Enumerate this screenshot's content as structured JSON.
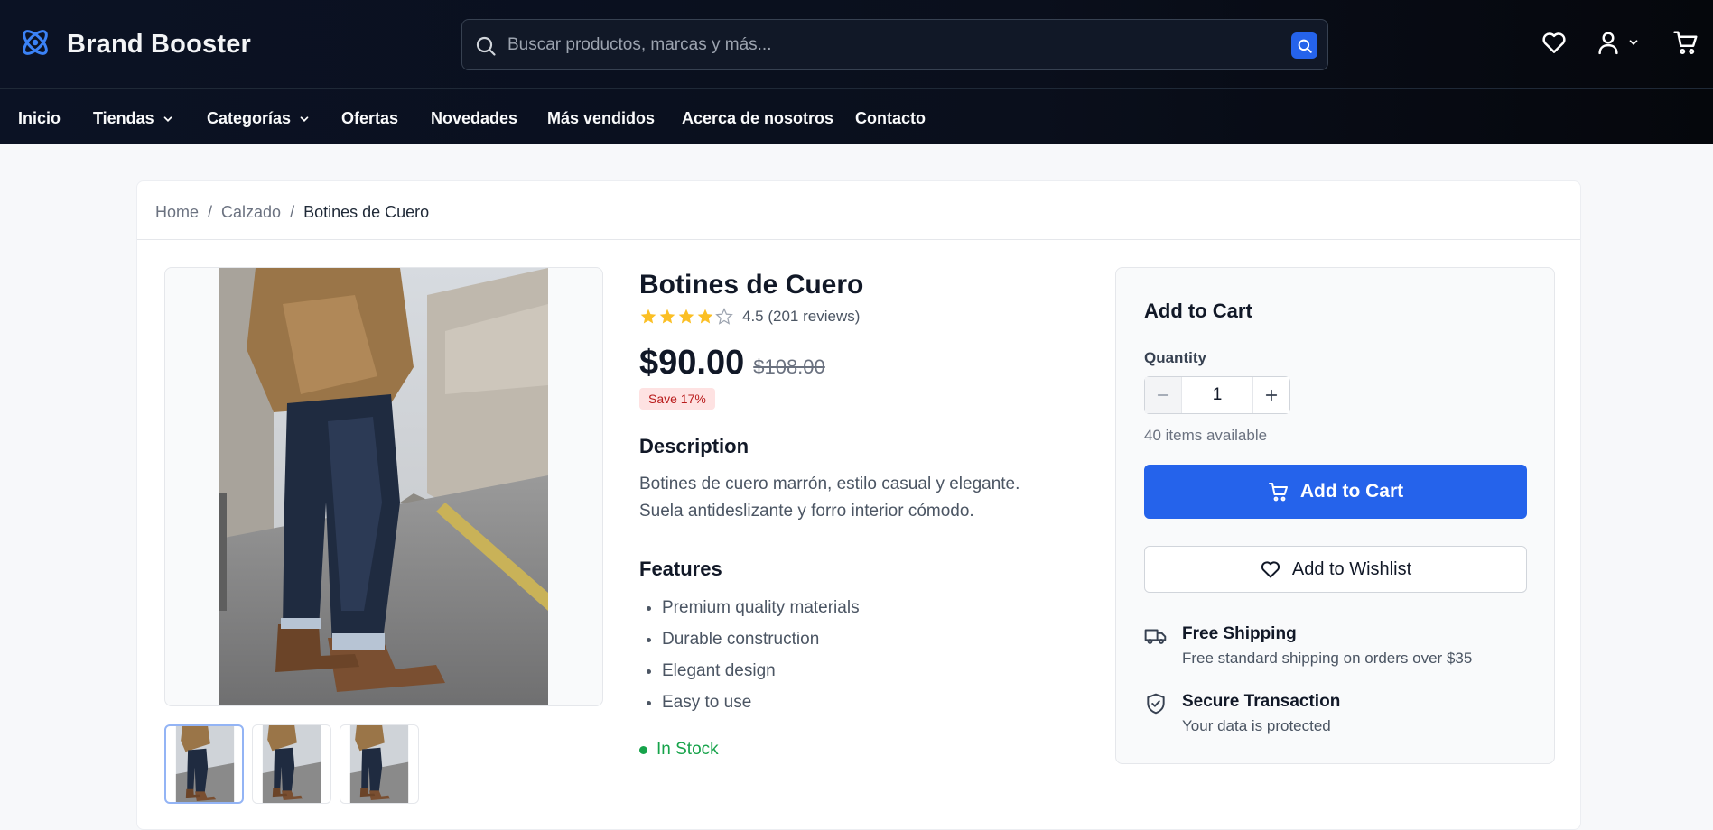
{
  "brand": {
    "name": "Brand Booster",
    "logo_icon": "atom-icon"
  },
  "search": {
    "placeholder": "Buscar productos, marcas y más..."
  },
  "nav": [
    {
      "label": "Inicio",
      "has_dropdown": false
    },
    {
      "label": "Tiendas",
      "has_dropdown": true
    },
    {
      "label": "Categorías",
      "has_dropdown": true
    },
    {
      "label": "Ofertas",
      "has_dropdown": false
    },
    {
      "label": "Novedades",
      "has_dropdown": false
    },
    {
      "label": "Más vendidos",
      "has_dropdown": false
    },
    {
      "label": "Acerca de nosotros",
      "has_dropdown": false
    },
    {
      "label": "Contacto",
      "has_dropdown": false
    }
  ],
  "breadcrumb": {
    "home": "Home",
    "sep": "/",
    "category": "Calzado",
    "current": "Botines de Cuero"
  },
  "product": {
    "title": "Botines de Cuero",
    "rating": 4.5,
    "rating_text": "4.5 (201 reviews)",
    "price": "$90.00",
    "old_price": "$108.00",
    "save": "Save 17%",
    "description_title": "Description",
    "description": "Botines de cuero marrón, estilo casual y elegante. Suela antideslizante y forro interior cómodo.",
    "features_title": "Features",
    "features": [
      "Premium quality materials",
      "Durable construction",
      "Elegant design",
      "Easy to use"
    ],
    "stock": "In Stock",
    "thumbnail_count": 3
  },
  "buy_box": {
    "title": "Add to Cart",
    "quantity_label": "Quantity",
    "quantity": "1",
    "available": "40 items available",
    "add_to_cart": "Add to Cart",
    "add_to_wishlist": "Add to Wishlist",
    "shipping_title": "Free Shipping",
    "shipping_sub": "Free standard shipping on orders over $35",
    "secure_title": "Secure Transaction",
    "secure_sub": "Your data is protected"
  },
  "colors": {
    "accent": "#2563eb",
    "header_bg": "#0b1224",
    "stock": "#16a34a",
    "sale_bg": "#fee2e2",
    "star": "#fbbf24"
  }
}
